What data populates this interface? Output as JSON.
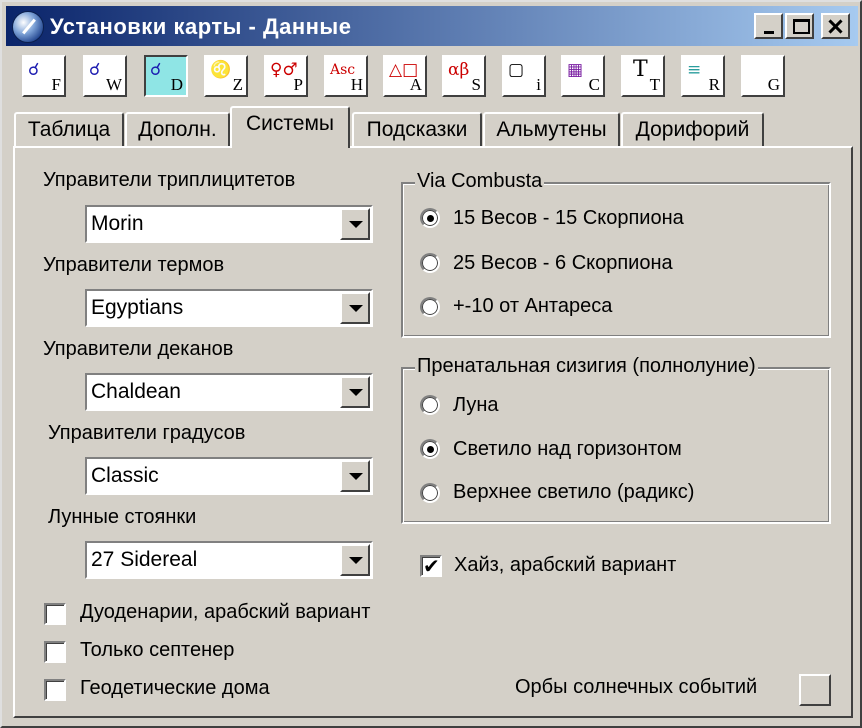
{
  "window": {
    "title": "Установки карты - Данные"
  },
  "toolbar": {
    "buttons": [
      {
        "glyph": "☌",
        "letter": "F",
        "icon": "aspect-circle-icon",
        "active": false
      },
      {
        "glyph": "☌",
        "letter": "W",
        "icon": "aspect-circle-icon",
        "active": false
      },
      {
        "glyph": "☌",
        "letter": "D",
        "icon": "aspect-circle-icon",
        "active": true
      },
      {
        "glyph": "♌",
        "letter": "Z",
        "icon": "zodiac-sign-icon",
        "active": false
      },
      {
        "glyph": "♀♂",
        "letter": "P",
        "icon": "planets-icon",
        "active": false
      },
      {
        "glyph": "Asc",
        "letter": "H",
        "icon": "houses-icon",
        "active": false
      },
      {
        "glyph": "△□",
        "letter": "A",
        "icon": "aspects-icon",
        "active": false
      },
      {
        "glyph": "αβ",
        "letter": "S",
        "icon": "stars-icon",
        "active": false
      },
      {
        "glyph": "▢",
        "letter": "i",
        "icon": "info-icon",
        "active": false
      },
      {
        "glyph": "▦",
        "letter": "C",
        "icon": "colors-icon",
        "active": false
      },
      {
        "glyph": "T",
        "letter": "T",
        "icon": "fonts-icon",
        "active": false
      },
      {
        "glyph": "≡",
        "letter": "R",
        "icon": "report-icon",
        "active": false
      },
      {
        "glyph": "",
        "letter": "G",
        "icon": "graphics-icon",
        "active": false
      }
    ]
  },
  "tabs": [
    "Таблица",
    "Дополн.",
    "Системы",
    "Подсказки",
    "Альмутены",
    "Дорифорий"
  ],
  "active_tab": "Системы",
  "rulers": {
    "triplicity": {
      "label": "Управители триплицитетов",
      "value": "Morin"
    },
    "terms": {
      "label": "Управители термов",
      "value": "Egyptians"
    },
    "decans": {
      "label": "Управители деканов",
      "value": "Chaldean"
    },
    "degrees": {
      "label": "Управители градусов",
      "value": "Classic"
    },
    "mansions": {
      "label": "Лунные стоянки",
      "value": "27 Sidereal"
    }
  },
  "via_combusta": {
    "title": "Via Combusta",
    "options": [
      "15 Весов - 15 Скорпиона",
      "25 Весов - 6 Скорпиона",
      "+-10 от Антареса"
    ],
    "selected": 0
  },
  "prenatal": {
    "title": "Пренатальная сизигия (полнолуние)",
    "options": [
      "Луна",
      "Светило над горизонтом",
      "Верхнее светило (радикс)"
    ],
    "selected": 1
  },
  "checks": {
    "hayz": {
      "label": "Хайз, арабский вариант",
      "checked": true
    },
    "duodenary": {
      "label": "Дуоденарии, арабский вариант",
      "checked": false
    },
    "septenary": {
      "label": "Только септенер",
      "checked": false
    },
    "geodetic": {
      "label": "Геодетические дома",
      "checked": false
    }
  },
  "solar_orbs": {
    "label": "Орбы солнечных событий"
  },
  "colors": {
    "title_start": "#0a246a",
    "title_end": "#a6caf0",
    "face": "#d4d0c8",
    "active_tool": "#8fe5e5"
  }
}
